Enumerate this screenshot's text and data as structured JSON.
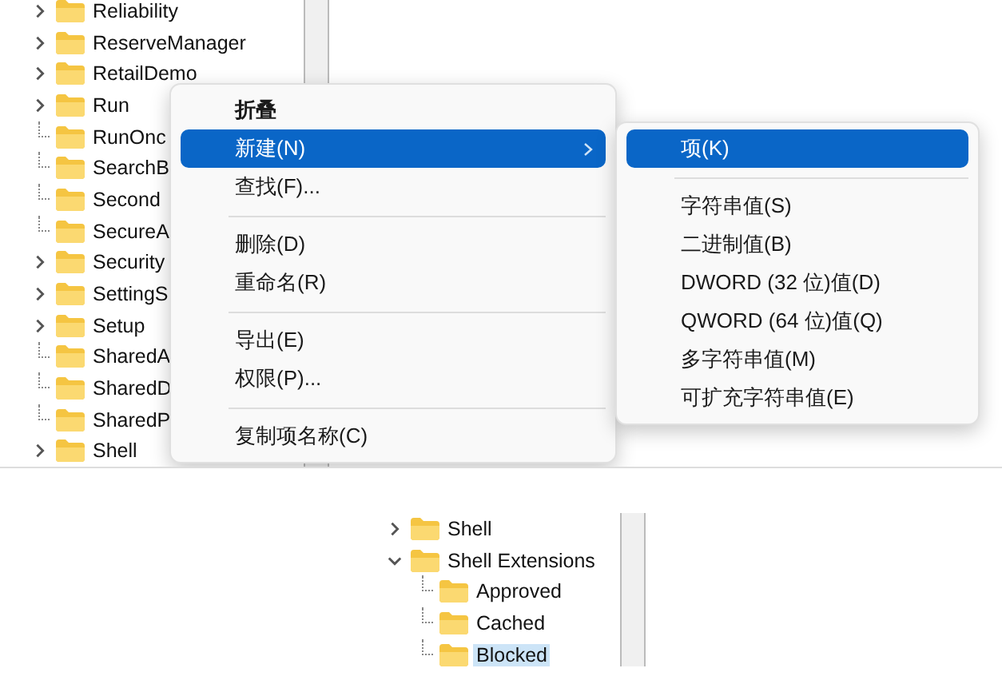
{
  "registry_tree": {
    "items": [
      {
        "label": "Reliability",
        "expandable": true,
        "expanded": false,
        "selected": false
      },
      {
        "label": "ReserveManager",
        "expandable": true,
        "expanded": false,
        "selected": false
      },
      {
        "label": "RetailDemo",
        "expandable": true,
        "expanded": false,
        "selected": false
      },
      {
        "label": "Run",
        "expandable": true,
        "expanded": false,
        "selected": false
      },
      {
        "label": "RunOnc",
        "expandable": false,
        "selected": false
      },
      {
        "label": "SearchB",
        "expandable": false,
        "selected": false
      },
      {
        "label": "Second",
        "expandable": false,
        "selected": false
      },
      {
        "label": "SecureA",
        "expandable": false,
        "selected": false
      },
      {
        "label": "Security",
        "expandable": true,
        "expanded": false,
        "selected": false
      },
      {
        "label": "SettingS",
        "expandable": true,
        "expanded": false,
        "selected": false
      },
      {
        "label": "Setup",
        "expandable": true,
        "expanded": false,
        "selected": false
      },
      {
        "label": "SharedA",
        "expandable": false,
        "selected": false
      },
      {
        "label": "SharedD",
        "expandable": false,
        "selected": false
      },
      {
        "label": "SharedP",
        "expandable": false,
        "selected": false
      },
      {
        "label": "Shell",
        "expandable": true,
        "expanded": false,
        "selected": false
      }
    ]
  },
  "context_menu": {
    "items": [
      {
        "kind": "item",
        "label": "折叠",
        "default": true,
        "selected": false,
        "submenu": false
      },
      {
        "kind": "item",
        "label": "新建(N)",
        "default": false,
        "selected": true,
        "submenu": true
      },
      {
        "kind": "item",
        "label": "查找(F)...",
        "default": false,
        "selected": false,
        "submenu": false
      },
      {
        "kind": "separator"
      },
      {
        "kind": "item",
        "label": "删除(D)",
        "default": false,
        "selected": false,
        "submenu": false
      },
      {
        "kind": "item",
        "label": "重命名(R)",
        "default": false,
        "selected": false,
        "submenu": false
      },
      {
        "kind": "separator"
      },
      {
        "kind": "item",
        "label": "导出(E)",
        "default": false,
        "selected": false,
        "submenu": false
      },
      {
        "kind": "item",
        "label": "权限(P)...",
        "default": false,
        "selected": false,
        "submenu": false
      },
      {
        "kind": "separator"
      },
      {
        "kind": "item",
        "label": "复制项名称(C)",
        "default": false,
        "selected": false,
        "submenu": false
      }
    ]
  },
  "new_submenu": {
    "items": [
      {
        "kind": "item",
        "label": "项(K)",
        "default": false,
        "selected": true,
        "submenu": false
      },
      {
        "kind": "separator"
      },
      {
        "kind": "item",
        "label": "字符串值(S)",
        "default": false,
        "selected": false,
        "submenu": false
      },
      {
        "kind": "item",
        "label": "二进制值(B)",
        "default": false,
        "selected": false,
        "submenu": false
      },
      {
        "kind": "item",
        "label": "DWORD (32 位)值(D)",
        "default": false,
        "selected": false,
        "submenu": false
      },
      {
        "kind": "item",
        "label": "QWORD (64 位)值(Q)",
        "default": false,
        "selected": false,
        "submenu": false
      },
      {
        "kind": "item",
        "label": "多字符串值(M)",
        "default": false,
        "selected": false,
        "submenu": false
      },
      {
        "kind": "item",
        "label": "可扩充字符串值(E)",
        "default": false,
        "selected": false,
        "submenu": false
      }
    ]
  },
  "result_tree": {
    "items": [
      {
        "label": "Shell",
        "expandable": true,
        "expanded": false,
        "selected": false
      },
      {
        "label": "Shell Extensions",
        "expandable": true,
        "expanded": true,
        "selected": false,
        "children": [
          {
            "label": "Approved",
            "expandable": false,
            "selected": false
          },
          {
            "label": "Cached",
            "expandable": false,
            "selected": false
          },
          {
            "label": "Blocked",
            "expandable": false,
            "selected": true
          }
        ]
      }
    ]
  }
}
